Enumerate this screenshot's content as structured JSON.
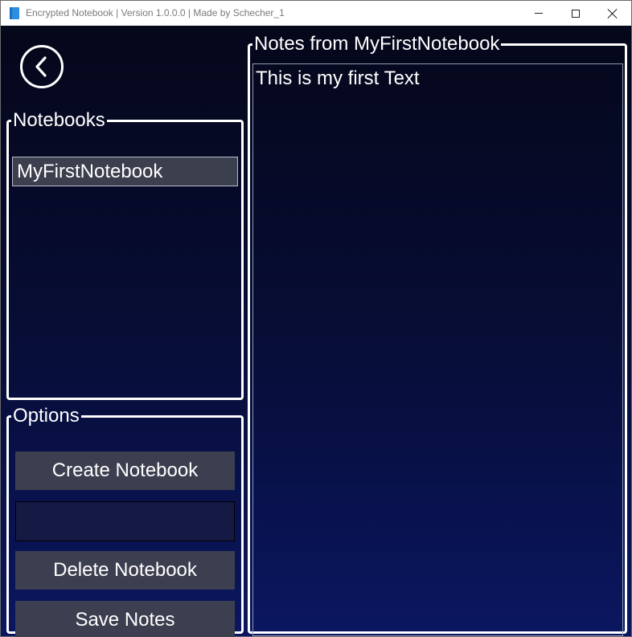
{
  "window": {
    "title": "Encrypted Notebook | Version 1.0.0.0 | Made by Schecher_1"
  },
  "back_button": {
    "icon": "chevron-left-icon"
  },
  "notebooks": {
    "header": "Notebooks",
    "items": [
      {
        "label": "MyFirstNotebook"
      }
    ]
  },
  "options": {
    "header": "Options",
    "create_label": "Create Notebook",
    "name_input_value": "",
    "delete_label": "Delete Notebook",
    "save_label": "Save Notes"
  },
  "notes": {
    "header": "Notes from MyFirstNotebook",
    "content": "This is my first Text"
  },
  "colors": {
    "background_top": "#05071a",
    "background_bottom": "#0a1660",
    "button": "#3c3f4f",
    "border": "#ffffff"
  }
}
